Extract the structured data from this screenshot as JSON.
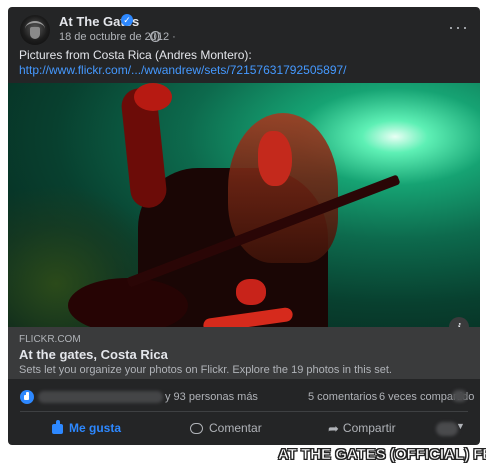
{
  "post": {
    "page_name": "At The Gates",
    "date": "18 de octubre de 2012 ·",
    "text": "Pictures from Costa Rica (Andres Montero):",
    "link": "http://www.flickr.com/.../wwandrew/sets/72157631792505897/",
    "verified_color": "#2d88ff"
  },
  "preview": {
    "domain": "FLICKR.COM",
    "title": "At the gates, Costa Rica",
    "description": "Sets let you organize your photos on Flickr. Explore the 19 photos in this set."
  },
  "stats": {
    "likers": "y 93 personas más",
    "comments": "5 comentarios",
    "shares": "6 veces compartido"
  },
  "actions": {
    "like": "Me gusta",
    "comment": "Comentar",
    "share": "Compartir"
  },
  "watermark": "AT THE GATES (OFFICIAL) FB",
  "colors": {
    "card_bg": "#242526",
    "accent": "#2d88ff",
    "link": "#4599ff"
  },
  "icons": [
    "verified-icon",
    "globe-icon",
    "more-options-icon",
    "info-icon",
    "like-reaction-icon",
    "thumbs-up-icon",
    "comment-icon",
    "share-icon",
    "chevron-down-icon"
  ]
}
